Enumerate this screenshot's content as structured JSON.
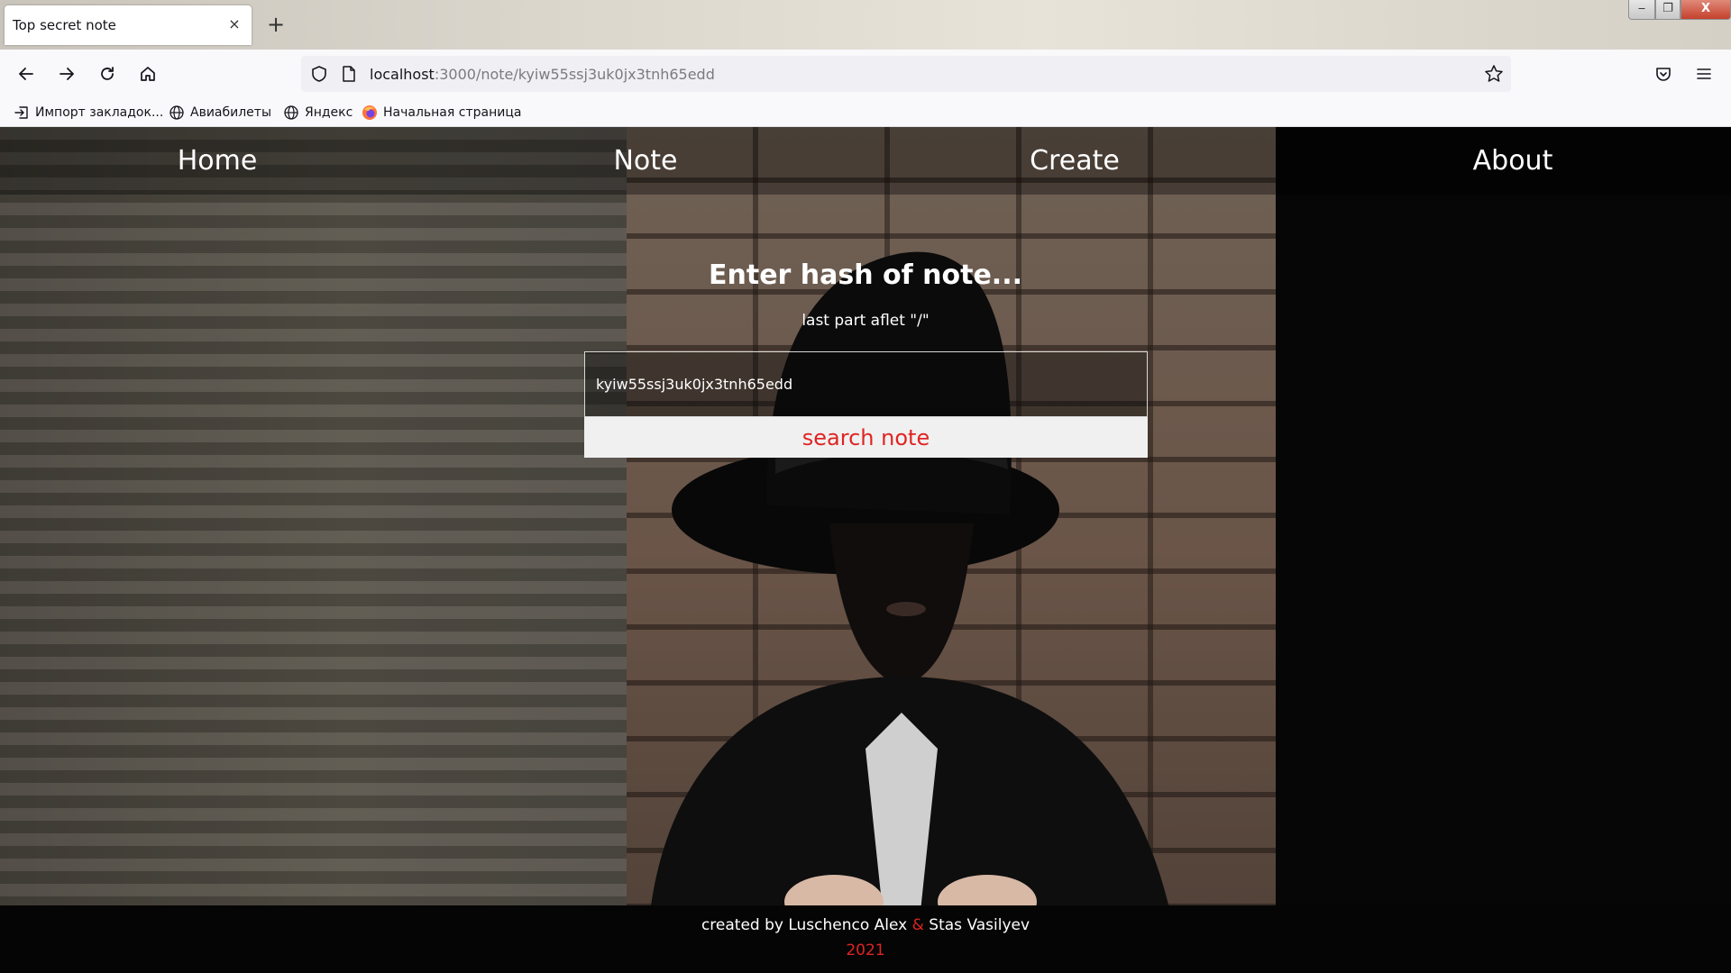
{
  "browser": {
    "tab_title": "Top secret note",
    "tab_close": "×",
    "new_tab": "+",
    "url_host": "localhost",
    "url_path": ":3000/note/kyiw55ssj3uk0jx3tnh65edd",
    "window_controls": {
      "min": "‒",
      "max": "❐",
      "close": "X"
    },
    "bookmarks": [
      {
        "label": "Импорт закладок...",
        "icon": "import-icon"
      },
      {
        "label": "Авиабилеты",
        "icon": "globe-icon"
      },
      {
        "label": "Яндекс",
        "icon": "globe-icon"
      },
      {
        "label": "Начальная страница",
        "icon": "firefox-icon"
      }
    ]
  },
  "site": {
    "nav": [
      "Home",
      "Note",
      "Create",
      "About"
    ],
    "search": {
      "title": "Enter hash of note...",
      "hint": "last part aflet \"/\"",
      "input_value": "kyiw55ssj3uk0jx3tnh65edd",
      "button_label": "search note"
    },
    "footer": {
      "prefix": "created by Luschenco Alex ",
      "amp": "&",
      "suffix": " Stas Vasilyev",
      "year": "2021"
    }
  },
  "colors": {
    "accent_red": "#e02424",
    "footer_bg": "#050505",
    "urlbar_bg": "#f0f0f4"
  }
}
